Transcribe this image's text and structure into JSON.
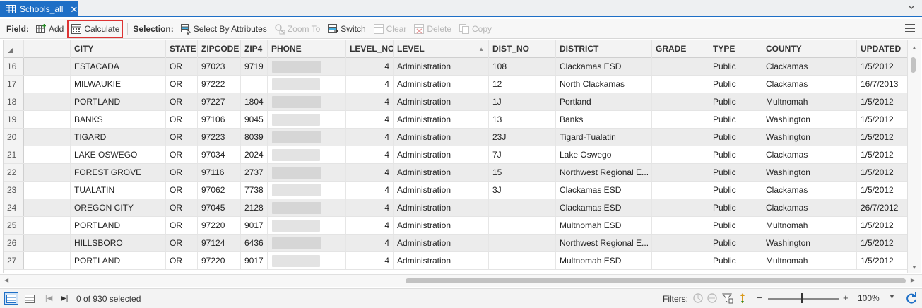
{
  "tab": {
    "title": "Schools_all",
    "close": "✕"
  },
  "toolbar": {
    "field_label": "Field:",
    "add_label": "Add",
    "calculate_label": "Calculate",
    "selection_label": "Selection:",
    "select_by_attributes_label": "Select By Attributes",
    "zoom_to_label": "Zoom To",
    "switch_label": "Switch",
    "clear_label": "Clear",
    "delete_label": "Delete",
    "copy_label": "Copy"
  },
  "table": {
    "columns": [
      "CITY",
      "STATE",
      "ZIPCODE",
      "ZIP4",
      "PHONE",
      "LEVEL_NO",
      "LEVEL",
      "DIST_NO",
      "DISTRICT",
      "GRADE",
      "TYPE",
      "COUNTY",
      "UPDATED"
    ],
    "rows": [
      {
        "num": "16",
        "city": "ESTACADA",
        "state": "OR",
        "zip": "97023",
        "zip4": "9719",
        "level_no": "4",
        "level": "Administration",
        "dist_no": "108",
        "district": "Clackamas ESD",
        "grade": "",
        "type": "Public",
        "county": "Clackamas",
        "updated": "1/5/2012"
      },
      {
        "num": "17",
        "city": "MILWAUKIE",
        "state": "OR",
        "zip": "97222",
        "zip4": "",
        "level_no": "4",
        "level": "Administration",
        "dist_no": "12",
        "district": "North Clackamas",
        "grade": "",
        "type": "Public",
        "county": "Clackamas",
        "updated": "16/7/2013"
      },
      {
        "num": "18",
        "city": "PORTLAND",
        "state": "OR",
        "zip": "97227",
        "zip4": "1804",
        "level_no": "4",
        "level": "Administration",
        "dist_no": "1J",
        "district": "Portland",
        "grade": "",
        "type": "Public",
        "county": "Multnomah",
        "updated": "1/5/2012"
      },
      {
        "num": "19",
        "city": "BANKS",
        "state": "OR",
        "zip": "97106",
        "zip4": "9045",
        "level_no": "4",
        "level": "Administration",
        "dist_no": "13",
        "district": "Banks",
        "grade": "",
        "type": "Public",
        "county": "Washington",
        "updated": "1/5/2012"
      },
      {
        "num": "20",
        "city": "TIGARD",
        "state": "OR",
        "zip": "97223",
        "zip4": "8039",
        "level_no": "4",
        "level": "Administration",
        "dist_no": "23J",
        "district": "Tigard-Tualatin",
        "grade": "",
        "type": "Public",
        "county": "Washington",
        "updated": "1/5/2012"
      },
      {
        "num": "21",
        "city": "LAKE OSWEGO",
        "state": "OR",
        "zip": "97034",
        "zip4": "2024",
        "level_no": "4",
        "level": "Administration",
        "dist_no": "7J",
        "district": "Lake Oswego",
        "grade": "",
        "type": "Public",
        "county": "Clackamas",
        "updated": "1/5/2012"
      },
      {
        "num": "22",
        "city": "FOREST GROVE",
        "state": "OR",
        "zip": "97116",
        "zip4": "2737",
        "level_no": "4",
        "level": "Administration",
        "dist_no": "15",
        "district": "Northwest Regional E...",
        "grade": "",
        "type": "Public",
        "county": "Washington",
        "updated": "1/5/2012"
      },
      {
        "num": "23",
        "city": "TUALATIN",
        "state": "OR",
        "zip": "97062",
        "zip4": "7738",
        "level_no": "4",
        "level": "Administration",
        "dist_no": "3J",
        "district": "Clackamas ESD",
        "grade": "",
        "type": "Public",
        "county": "Clackamas",
        "updated": "1/5/2012"
      },
      {
        "num": "24",
        "city": "OREGON CITY",
        "state": "OR",
        "zip": "97045",
        "zip4": "2128",
        "level_no": "4",
        "level": "Administration",
        "dist_no": "",
        "district": "Clackamas ESD",
        "grade": "",
        "type": "Public",
        "county": "Clackamas",
        "updated": "26/7/2012"
      },
      {
        "num": "25",
        "city": "PORTLAND",
        "state": "OR",
        "zip": "97220",
        "zip4": "9017",
        "level_no": "4",
        "level": "Administration",
        "dist_no": "",
        "district": "Multnomah ESD",
        "grade": "",
        "type": "Public",
        "county": "Multnomah",
        "updated": "1/5/2012"
      },
      {
        "num": "26",
        "city": "HILLSBORO",
        "state": "OR",
        "zip": "97124",
        "zip4": "6436",
        "level_no": "4",
        "level": "Administration",
        "dist_no": "",
        "district": "Northwest Regional E...",
        "grade": "",
        "type": "Public",
        "county": "Washington",
        "updated": "1/5/2012"
      },
      {
        "num": "27",
        "city": "PORTLAND",
        "state": "OR",
        "zip": "97220",
        "zip4": "9017",
        "level_no": "4",
        "level": "Administration",
        "dist_no": "",
        "district": "Multnomah ESD",
        "grade": "",
        "type": "Public",
        "county": "Multnomah",
        "updated": "1/5/2012"
      }
    ]
  },
  "status": {
    "selected_text": "0 of 930 selected",
    "filters_label": "Filters:",
    "zoom_value": "100%",
    "zoom_minus": "−",
    "zoom_plus": "+"
  },
  "colors": {
    "accent": "#1e6fc6",
    "highlight_outline": "#d33333"
  }
}
